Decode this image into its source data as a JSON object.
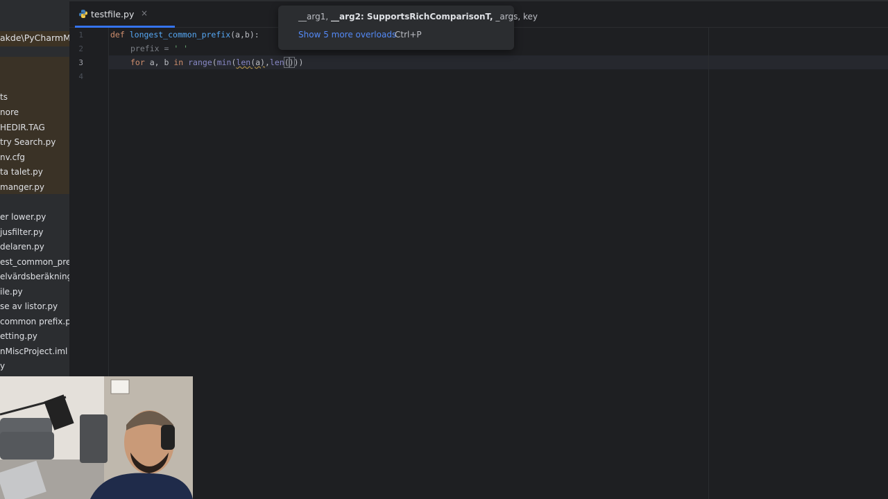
{
  "tab": {
    "label": "testfile.py",
    "close": "×"
  },
  "sidebar": {
    "header": "akde\\PyCharmMis",
    "items": [
      "ts",
      "nore",
      "HEDIR.TAG",
      "try Search.py",
      "nv.cfg",
      "ta talet.py",
      "manger.py",
      "er lower.py",
      "jusfilter.py",
      "delaren.py",
      "est_common_prefi",
      "elvärdsberäkning.p",
      "ile.py",
      "se av listor.py",
      " common prefix.py",
      "etting.py",
      "nMiscProject.iml",
      "y"
    ]
  },
  "editor": {
    "line_numbers": [
      "1",
      "2",
      "3",
      "4"
    ],
    "line1": {
      "kw": "def",
      "fn": "longest_common_prefix",
      "args": "(a,b):"
    },
    "line2": {
      "var": "prefix",
      "op": " = ",
      "str": "' '"
    },
    "line3": {
      "kw_for": "for",
      "vars": " a, b ",
      "kw_in": "in",
      "range": "range",
      "p1": "(",
      "min": "min",
      "p2": "(",
      "len1": "len",
      "a_arg": "(a)",
      "comma": ",",
      "len2": "len",
      "paren_open": "(",
      "paren_close": ")",
      "tail": "))"
    }
  },
  "popup": {
    "sig_prefix": "__arg1, ",
    "sig_bold": "__arg2: SupportsRichComparisonT,",
    "sig_suffix": " _args, key",
    "more_overloads": "Show 5 more overloads",
    "shortcut": "Ctrl+P"
  },
  "colors": {
    "accent": "#3574f0",
    "keyword": "#cf8e6d",
    "function": "#56a8f5",
    "string": "#6aab73"
  }
}
